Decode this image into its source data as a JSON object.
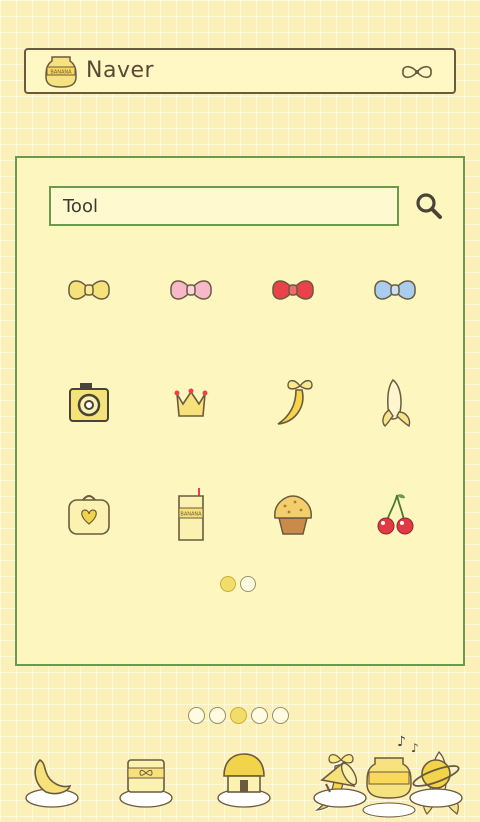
{
  "widget": {
    "label": "Naver",
    "jar_text": "BANANA"
  },
  "folder": {
    "name": "Tool",
    "icons": [
      {
        "name": "bow-yellow-icon",
        "color": "#f4e27a"
      },
      {
        "name": "bow-pink-icon",
        "color": "#f7b9c9"
      },
      {
        "name": "bow-red-icon",
        "color": "#e9424a"
      },
      {
        "name": "bow-blue-icon",
        "color": "#a9ccef"
      },
      {
        "name": "camera-icon",
        "color": "#f4e27a"
      },
      {
        "name": "crown-icon",
        "color": "#f6e17a"
      },
      {
        "name": "banana-bow-icon",
        "color": "#f6d54a"
      },
      {
        "name": "peeled-banana-icon",
        "color": "#f6e48a"
      },
      {
        "name": "bag-heart-icon",
        "color": "#fbf1b0"
      },
      {
        "name": "milk-carton-icon",
        "color": "#fbf1b0"
      },
      {
        "name": "muffin-icon",
        "color": "#f2cf6a"
      },
      {
        "name": "cherry-icon",
        "color": "#e23a44"
      }
    ],
    "carton_text": "BANANA",
    "page_count": 2,
    "active_page": 1
  },
  "home_pages": {
    "count": 5,
    "active": 3
  },
  "dock": [
    "banana-peel-icon",
    "milk-box-icon",
    "house-icon",
    "megaphone-icon",
    "planet-icon"
  ],
  "colors": {
    "accent_green": "#6c9a4c",
    "outline_brown": "#6b5a3e",
    "bg_yellow": "#fbf0b8"
  }
}
